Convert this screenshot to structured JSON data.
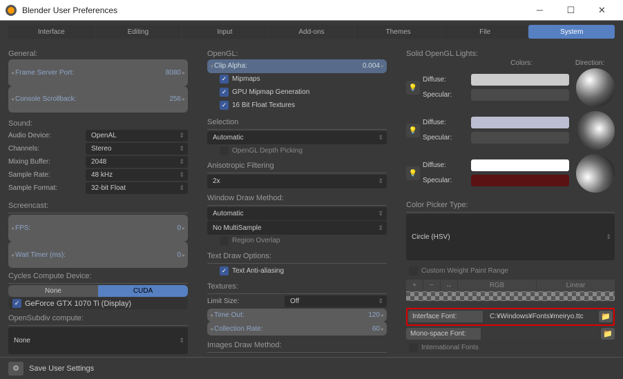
{
  "window": {
    "title": "Blender User Preferences"
  },
  "tabs": [
    "Interface",
    "Editing",
    "Input",
    "Add-ons",
    "Themes",
    "File",
    "System"
  ],
  "col1": {
    "general": {
      "label": "General:",
      "frameServer": {
        "label": "Frame Server Port:",
        "value": "8080"
      },
      "console": {
        "label": "Console Scrollback:",
        "value": "256"
      }
    },
    "sound": {
      "label": "Sound:",
      "audioDevice": {
        "label": "Audio Device:",
        "value": "OpenAL"
      },
      "channels": {
        "label": "Channels:",
        "value": "Stereo"
      },
      "mixing": {
        "label": "Mixing Buffer:",
        "value": "2048"
      },
      "sampleRate": {
        "label": "Sample Rate:",
        "value": "48 kHz"
      },
      "sampleFormat": {
        "label": "Sample Format:",
        "value": "32-bit Float"
      }
    },
    "screencast": {
      "label": "Screencast:",
      "fps": {
        "label": "FPS:",
        "value": "0"
      },
      "wait": {
        "label": "Wait Timer (ms):",
        "value": "0"
      }
    },
    "cycles": {
      "label": "Cycles Compute Device:",
      "none": "None",
      "cuda": "CUDA",
      "device": "GeForce GTX 1070 Ti (Display)"
    },
    "opensubdiv": {
      "label": "OpenSubdiv compute:",
      "value": "None"
    }
  },
  "col2": {
    "opengl": {
      "label": "OpenGL:",
      "clipAlpha": {
        "label": "Clip Alpha:",
        "value": "0.004"
      },
      "mipmaps": "Mipmaps",
      "gpuMipmap": "GPU Mipmap Generation",
      "float16": "16 Bit Float Textures"
    },
    "selection": {
      "label": "Selection",
      "value": "Automatic",
      "depthPicking": "OpenGL Depth Picking"
    },
    "aniso": {
      "label": "Anisotropic Filtering",
      "value": "2x"
    },
    "winDraw": {
      "label": "Window Draw Method:",
      "auto": "Automatic",
      "multisample": "No MultiSample",
      "regionOverlap": "Region Overlap"
    },
    "textDraw": {
      "label": "Text Draw Options:",
      "aa": "Text Anti-aliasing"
    },
    "textures": {
      "label": "Textures:",
      "limitSize": {
        "label": "Limit Size:",
        "value": "Off"
      },
      "timeOut": {
        "label": "Time Out:",
        "value": "120"
      },
      "collectionRate": {
        "label": "Collection Rate:",
        "value": "60"
      }
    },
    "imagesDraw": {
      "label": "Images Draw Method:"
    }
  },
  "col3": {
    "solidLights": {
      "label": "Solid OpenGL Lights:",
      "colors": "Colors:",
      "direction": "Direction:",
      "diffuse": "Diffuse:",
      "specular": "Specular:"
    },
    "colorPicker": {
      "label": "Color Picker Type:",
      "value": "Circle (HSV)"
    },
    "customWeight": "Custom Weight Paint Range",
    "plus": "+",
    "minus": "−",
    "swap": "↔",
    "rgb": "RGB",
    "linear": "Linear",
    "interfaceFont": {
      "label": "Interface Font:",
      "value": "C:¥Windows¥Fonts¥meiryo.ttc"
    },
    "monoFont": {
      "label": "Mono-space Font:",
      "value": ""
    },
    "international": "International Fonts"
  },
  "footer": {
    "save": "Save User Settings"
  },
  "chart_data": null
}
